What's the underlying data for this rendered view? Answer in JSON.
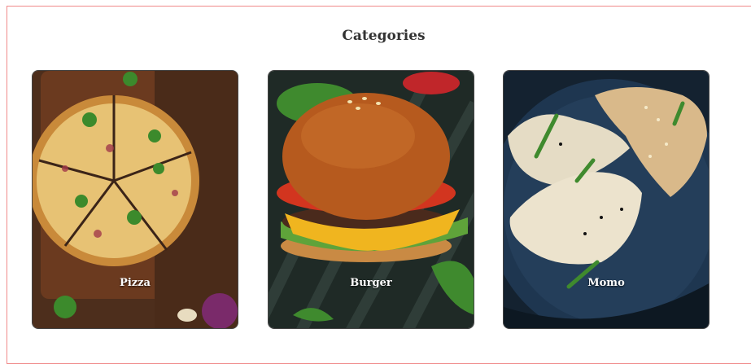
{
  "page": {
    "title": "Categories"
  },
  "categories": [
    {
      "label": "Pizza"
    },
    {
      "label": "Burger"
    },
    {
      "label": "Momo"
    }
  ]
}
